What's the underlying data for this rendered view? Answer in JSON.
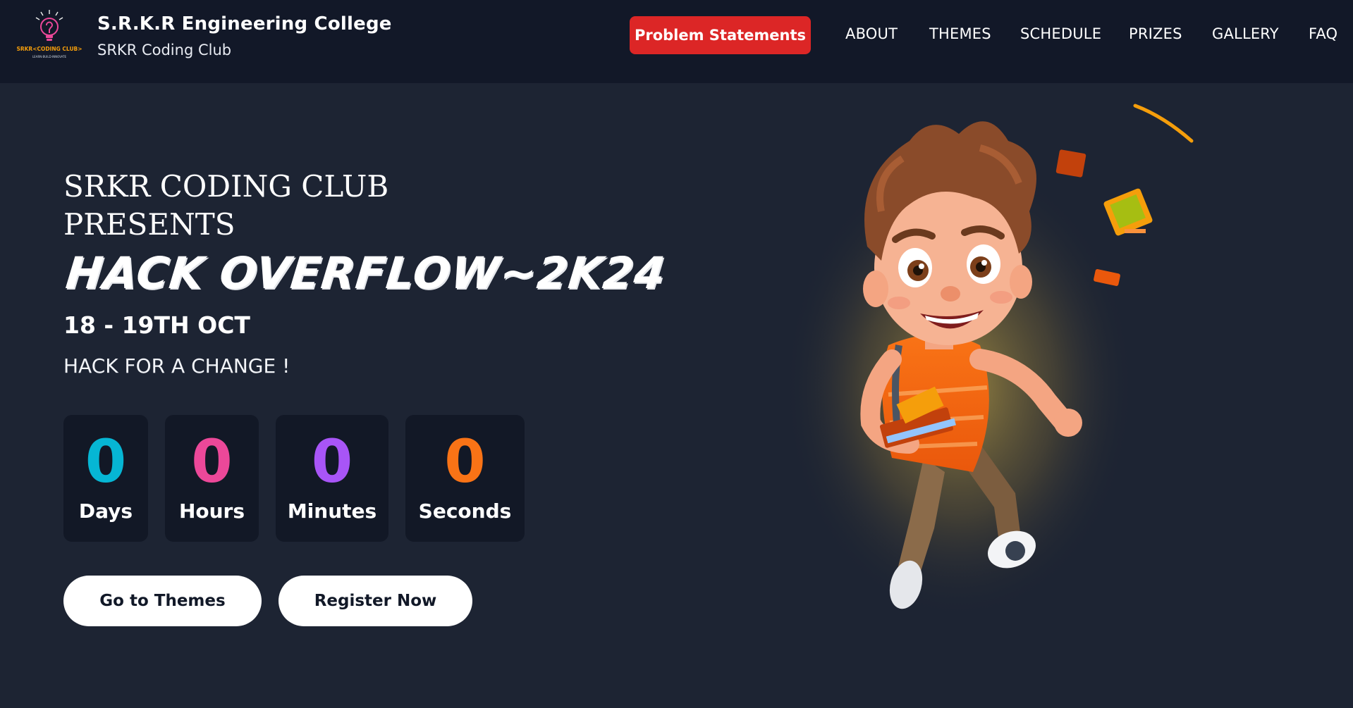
{
  "header": {
    "logo_text": "SRKR<CODING CLUB>",
    "logo_tagline": "LEARN·BUILD·INNOVATE",
    "title": "S.R.K.R Engineering College",
    "subtitle": "SRKR Coding Club",
    "problem_button": "Problem Statements",
    "nav": [
      "ABOUT",
      "THEMES",
      "SCHEDULE",
      "PRIZES",
      "GALLERY",
      "FAQ"
    ]
  },
  "hero": {
    "presents": "SRKR CODING CLUB PRESENTS",
    "event_title": "HACK OVERFLOW~2K24",
    "date": "18 - 19TH OCT",
    "tagline": "HACK FOR A CHANGE !",
    "countdown": [
      {
        "value": "0",
        "label": "Days",
        "color": "#06b6d4"
      },
      {
        "value": "0",
        "label": "Hours",
        "color": "#ec4899"
      },
      {
        "value": "0",
        "label": "Minutes",
        "color": "#a855f7"
      },
      {
        "value": "0",
        "label": "Seconds",
        "color": "#f97316"
      }
    ],
    "buttons": {
      "themes": "Go to Themes",
      "register": "Register Now"
    },
    "illustration": "running-student-character"
  },
  "colors": {
    "page_bg": "#1d2433",
    "header_bg": "#121828",
    "accent_red": "#dc2626",
    "card_bg": "#121826"
  }
}
